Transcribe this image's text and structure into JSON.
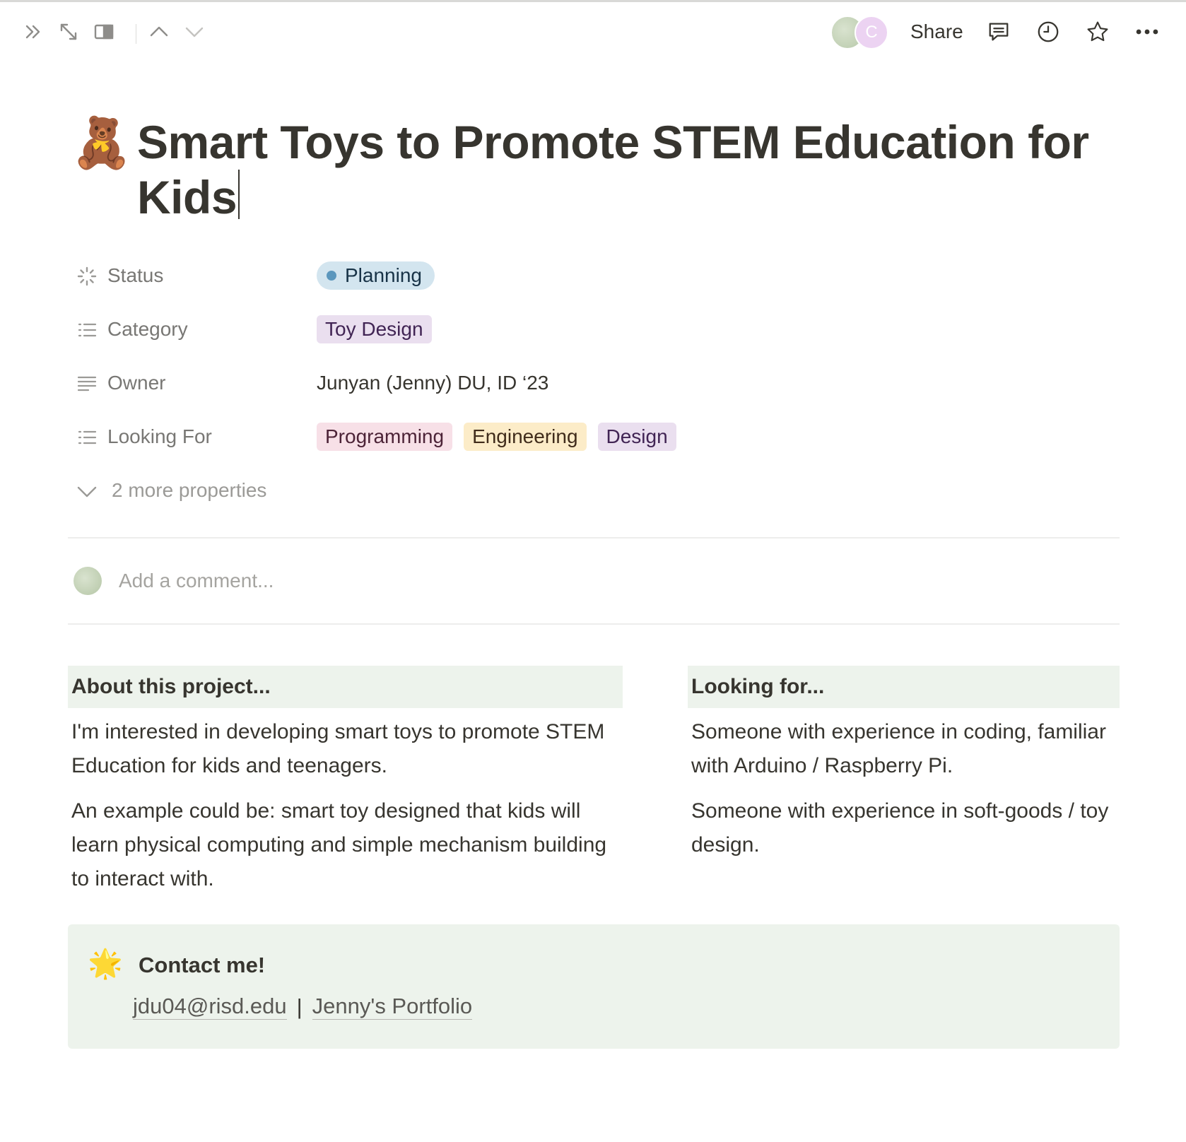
{
  "topbar": {
    "share_label": "Share",
    "avatar_initial": "C"
  },
  "page": {
    "icon": "🧸",
    "title": "Smart Toys to Promote STEM Education for Kids"
  },
  "properties": {
    "status": {
      "label": "Status",
      "value": "Planning",
      "color": "#5b97bd"
    },
    "category": {
      "label": "Category",
      "value": "Toy Design"
    },
    "owner": {
      "label": "Owner",
      "value": "Junyan (Jenny) DU, ID ‘23"
    },
    "looking_for": {
      "label": "Looking For",
      "tags": [
        {
          "text": "Programming",
          "bg": "#f7e0e7",
          "fg": "#4c2337"
        },
        {
          "text": "Engineering",
          "bg": "#fcecc8",
          "fg": "#402c1b"
        },
        {
          "text": "Design",
          "bg": "#eadfef",
          "fg": "#412454"
        }
      ]
    },
    "more_label": "2 more properties"
  },
  "comment": {
    "placeholder": "Add a comment..."
  },
  "about": {
    "heading": "About this project...",
    "paragraphs": [
      "I'm interested in developing smart toys to promote STEM Education for kids and teenagers.",
      "An example could be: smart toy designed that kids will learn physical computing and simple mechanism building to interact with."
    ]
  },
  "looking": {
    "heading": "Looking for...",
    "paragraphs": [
      "Someone with experience in coding, familiar with Arduino / Raspberry Pi.",
      "Someone with experience in soft-goods / toy design."
    ]
  },
  "callout": {
    "icon": "🌟",
    "title": "Contact me!",
    "email": "jdu04@risd.edu",
    "separator": "|",
    "portfolio": "Jenny's Portfolio"
  },
  "colors": {
    "heading_bg": "#edf3ec",
    "status_bg": "#d3e5ef",
    "category_bg": "#eadfef"
  }
}
